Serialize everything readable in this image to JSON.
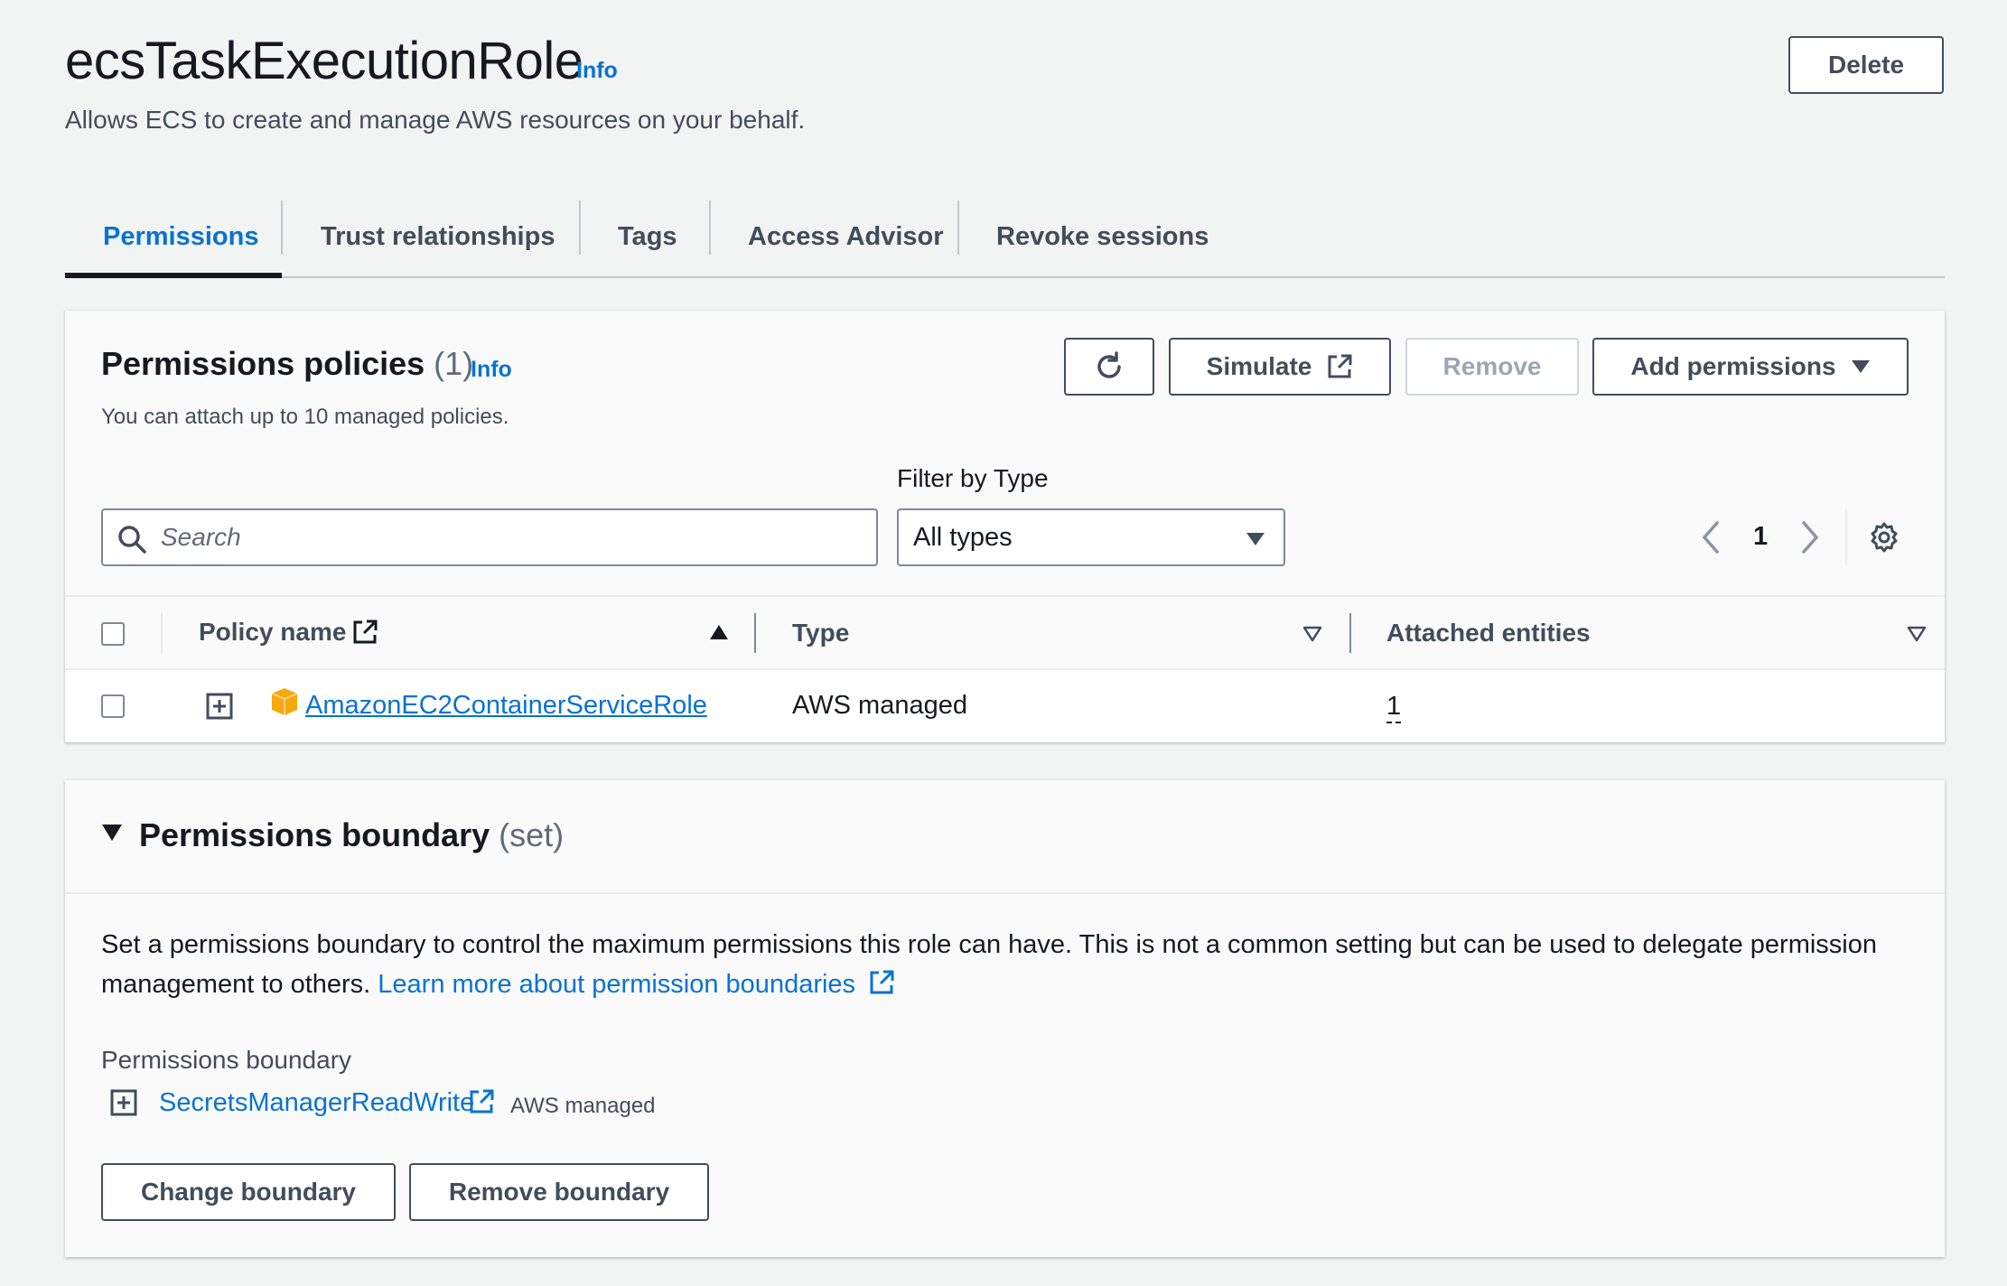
{
  "header": {
    "title": "ecsTaskExecutionRole",
    "info": "Info",
    "description": "Allows ECS to create and manage AWS resources on your behalf.",
    "delete_label": "Delete"
  },
  "tabs": [
    {
      "label": "Permissions",
      "active": true
    },
    {
      "label": "Trust relationships"
    },
    {
      "label": "Tags"
    },
    {
      "label": "Access Advisor"
    },
    {
      "label": "Revoke sessions"
    }
  ],
  "policies": {
    "title": "Permissions policies",
    "count": "(1)",
    "info": "Info",
    "description": "You can attach up to 10 managed policies.",
    "refresh_icon": "refresh-icon",
    "simulate_label": "Simulate",
    "remove_label": "Remove",
    "add_label": "Add permissions",
    "search_placeholder": "Search",
    "filter_label": "Filter by Type",
    "filter_value": "All types",
    "page": "1",
    "columns": {
      "policy_name": "Policy name",
      "type": "Type",
      "attached": "Attached entities"
    },
    "rows": [
      {
        "name": "AmazonEC2ContainerServiceRole",
        "type": "AWS managed",
        "attached": "1"
      }
    ]
  },
  "boundary": {
    "title": "Permissions boundary",
    "status": "(set)",
    "description": "Set a permissions boundary to control the maximum permissions this role can have. This is not a common setting but can be used to delegate permission management to others.",
    "learn_more": "Learn more about permission boundaries",
    "field_label": "Permissions boundary",
    "policy_name": "SecretsManagerReadWrite",
    "policy_type": "AWS managed",
    "change_label": "Change boundary",
    "remove_label": "Remove boundary"
  },
  "colors": {
    "link": "#0972d3",
    "text": "#16191f",
    "muted": "#414d5c",
    "background": "#f2f3f3",
    "aws_orange": "#f7a80d"
  }
}
